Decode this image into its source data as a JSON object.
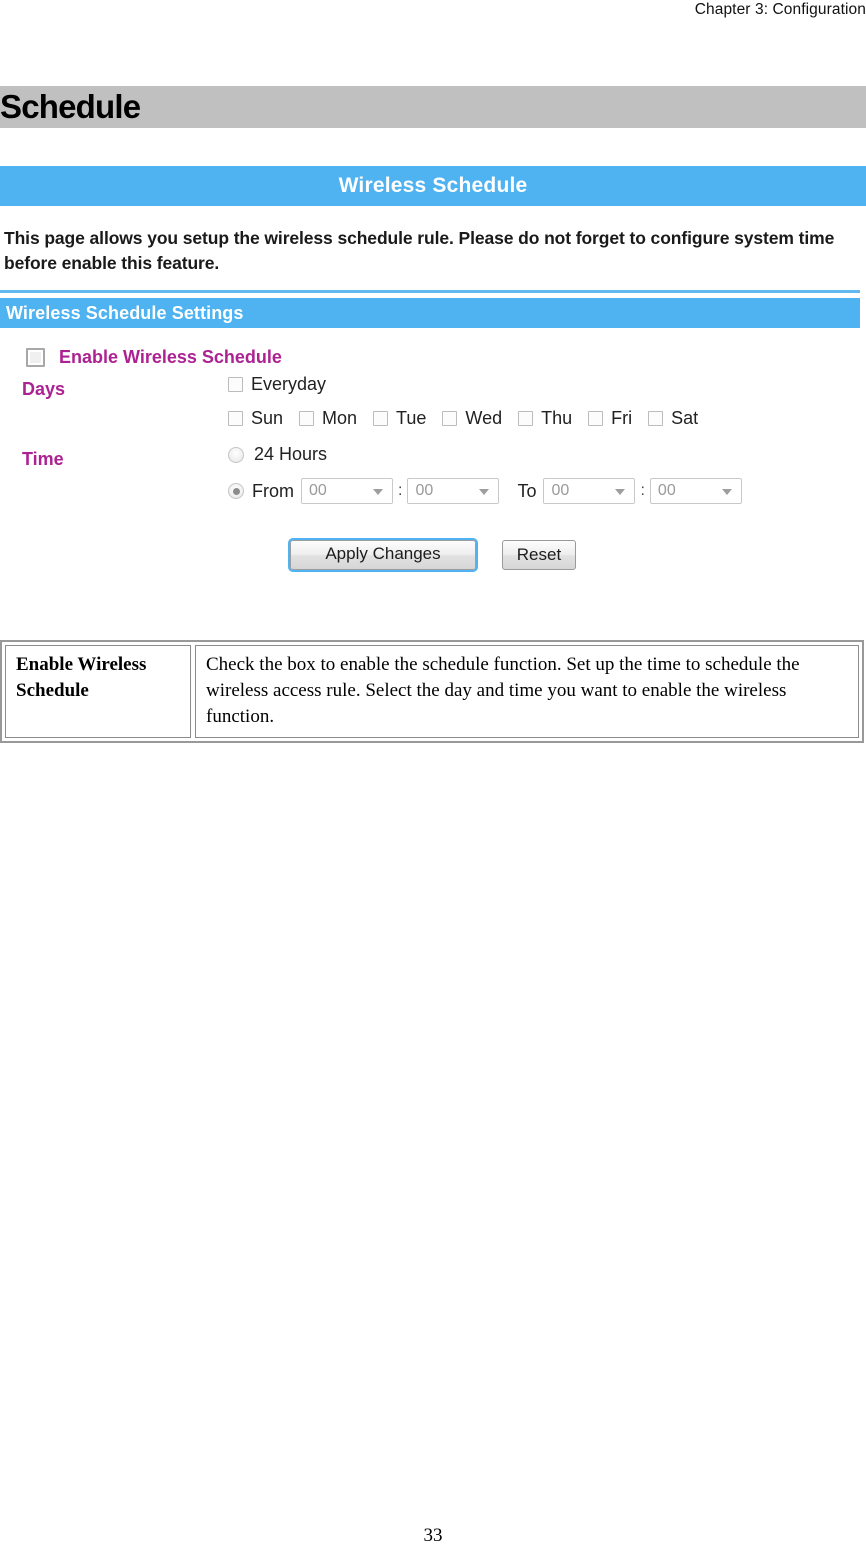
{
  "running_header": "Chapter 3: Configuration",
  "chapter_title": "Schedule",
  "panel": {
    "titlebar": "Wireless Schedule",
    "description": "This page allows you setup the wireless schedule rule. Please do not forget to configure system time before enable this feature.",
    "section_title": "Wireless Schedule Settings",
    "enable": {
      "label": "Enable Wireless Schedule",
      "checked": false
    },
    "days": {
      "label": "Days",
      "everyday": {
        "label": "Everyday",
        "checked": false
      },
      "items": [
        {
          "label": "Sun",
          "checked": false
        },
        {
          "label": "Mon",
          "checked": false
        },
        {
          "label": "Tue",
          "checked": false
        },
        {
          "label": "Wed",
          "checked": false
        },
        {
          "label": "Thu",
          "checked": false
        },
        {
          "label": "Fri",
          "checked": false
        },
        {
          "label": "Sat",
          "checked": false
        }
      ]
    },
    "time": {
      "label": "Time",
      "all_day": {
        "label": "24 Hours",
        "selected": false
      },
      "range": {
        "selected": true,
        "from_label": "From",
        "to_label": "To",
        "separator": ":",
        "from_hour": "00",
        "from_minute": "00",
        "to_hour": "00",
        "to_minute": "00"
      }
    },
    "buttons": {
      "apply": "Apply Changes",
      "reset": "Reset"
    }
  },
  "description_table": {
    "term": "Enable Wireless Schedule",
    "definition": "Check the box to enable the schedule function. Set up the time to schedule the wireless access rule. Select the day and time you want to enable the wireless function."
  },
  "page_number": "33",
  "colors": {
    "panel_blue": "#4eb3f0",
    "title_band_gray": "#c0c0c0",
    "label_magenta": "#ad2292"
  }
}
